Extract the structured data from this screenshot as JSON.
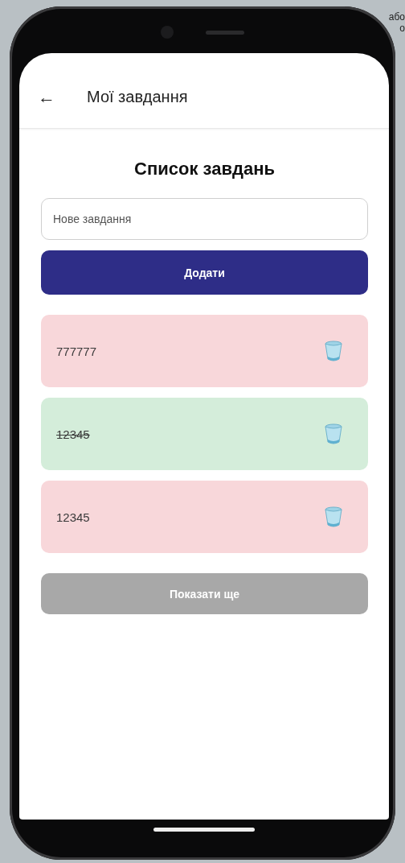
{
  "desktop_fragments": [
    "або",
    "о"
  ],
  "app_bar": {
    "back_icon": "←",
    "title": "Мої завдання"
  },
  "heading": "Список завдань",
  "new_task": {
    "placeholder": "Нове завдання"
  },
  "add_button": "Додати",
  "tasks": [
    {
      "text": "777777",
      "done": false
    },
    {
      "text": "12345",
      "done": true
    },
    {
      "text": "12345",
      "done": false
    }
  ],
  "more_button": {
    "label": "Показати ще",
    "disabled": true
  }
}
